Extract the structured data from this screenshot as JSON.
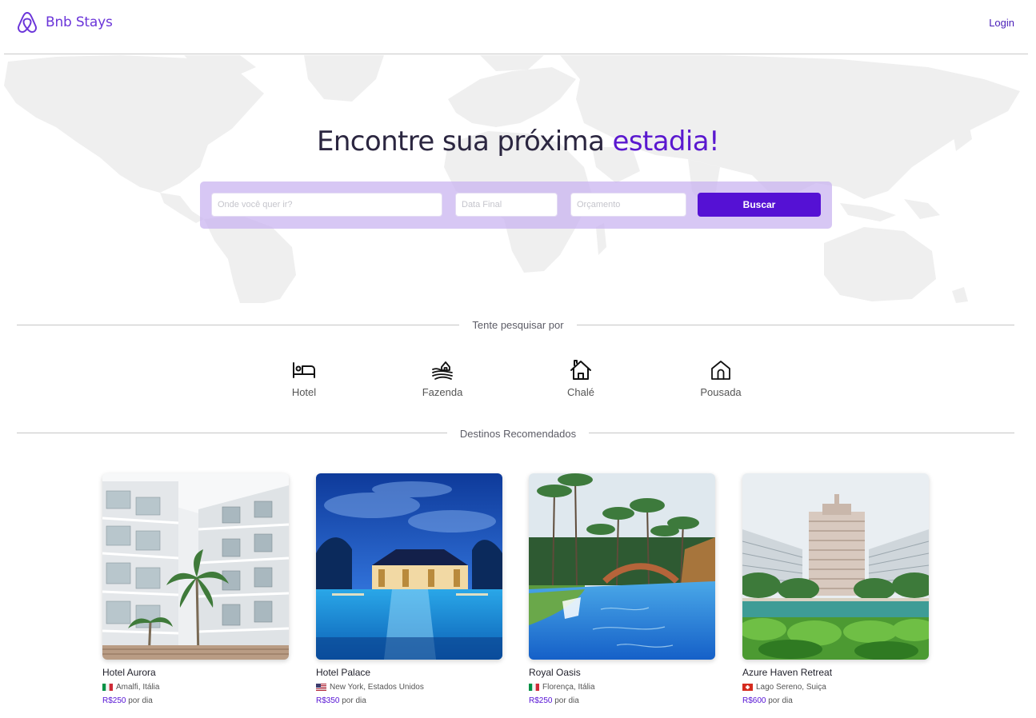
{
  "brand": {
    "name": "Bnb Stays"
  },
  "nav": {
    "login_label": "Login"
  },
  "hero": {
    "title_prefix": "Encontre sua próxima ",
    "title_highlight": "estadia!",
    "search": {
      "destination_placeholder": "Onde você quer ir?",
      "end_date_placeholder": "Data Final",
      "budget_placeholder": "Orçamento",
      "search_label": "Buscar"
    }
  },
  "categories_section": {
    "heading": "Tente pesquisar por",
    "items": [
      {
        "label": "Hotel",
        "icon": "bed-icon"
      },
      {
        "label": "Fazenda",
        "icon": "farm-icon"
      },
      {
        "label": "Chalé",
        "icon": "chalet-icon"
      },
      {
        "label": "Pousada",
        "icon": "house-icon"
      }
    ]
  },
  "destinations_section": {
    "heading": "Destinos Recomendados",
    "cards": [
      {
        "name": "Hotel Aurora",
        "location": "Amalfi, Itália",
        "flag": "italy-flag",
        "price": "R$250",
        "price_suffix": " por dia"
      },
      {
        "name": "Hotel Palace",
        "location": "New York, Estados Unidos",
        "flag": "usa-flag",
        "price": "R$350",
        "price_suffix": " por dia"
      },
      {
        "name": "Royal Oasis",
        "location": "Florença, Itália",
        "flag": "italy-flag",
        "price": "R$250",
        "price_suffix": " por dia"
      },
      {
        "name": "Azure Haven Retreat",
        "location": "Lago Sereno, Suiça",
        "flag": "switzerland-flag",
        "price": "R$600",
        "price_suffix": " por dia"
      }
    ]
  },
  "colors": {
    "accent": "#5511d4",
    "brand": "#6b35d9",
    "search_panel": "#c8b2f0",
    "map": "#efefef"
  }
}
